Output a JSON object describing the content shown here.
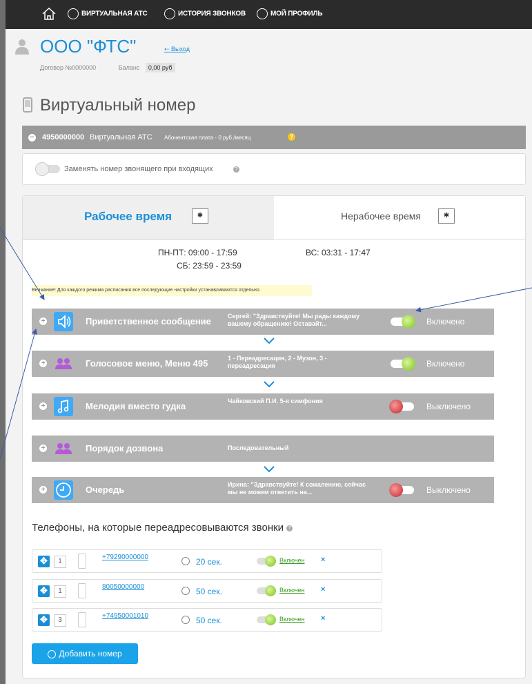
{
  "nav": {
    "pbx": "ВИРТУАЛЬНАЯ АТС",
    "history": "ИСТОРИЯ ЗВОНКОВ",
    "profile": "МОЙ ПРОФИЛЬ"
  },
  "company": {
    "name": "ООО \"ФТС\"",
    "logout": "Выход",
    "contract": "Договор №0000000",
    "balance_label": "Баланс",
    "balance_value": "0,00 руб"
  },
  "section_title": "Виртуальный номер",
  "vnumber": {
    "number": "4950000000",
    "type": "Виртуальная АТС",
    "fee": "Абонентская плата - 0 руб./месяц"
  },
  "replace_caller": "Заменять номер звонящего при входящих",
  "tabs": {
    "work": "Рабочее время",
    "off": "Нерабочее время"
  },
  "schedule": {
    "weekdays": "ПН-ПТ: 09:00 - 17:59",
    "sunday": "ВС: 03:31 - 17:47",
    "saturday": "СБ: 23:59 - 23:59"
  },
  "warning": "Внимание! Для каждого режима расписания все последующие настройки устанавливаются отдельно.",
  "features": [
    {
      "title": "Приветственное сообщение",
      "desc": "Сергей: \"Здравствуйте! Мы рады каждому вашему обращению! Оставайт...",
      "state": "Включено",
      "on": true,
      "icon": "speaker-icon"
    },
    {
      "title": "Голосовое меню, Меню 495",
      "desc": "1 - Переадресация, 2 - Музон, 3 - переадресация",
      "state": "Включено",
      "on": true,
      "icon": "people-icon"
    },
    {
      "title": "Мелодия вместо гудка",
      "desc": "Чайковский П.И. 5-я симфония",
      "state": "Выключено",
      "on": false,
      "icon": "music-note-icon"
    },
    {
      "title": "Порядок дозвона",
      "desc": "Последовательный",
      "state": "",
      "on": null,
      "icon": "people-icon"
    },
    {
      "title": "Очередь",
      "desc": "Ирина: \"Здравствуйте! К сожалению, сейчас мы не можем ответить на...",
      "state": "Выключено",
      "on": false,
      "icon": "clock-icon"
    }
  ],
  "forward_title": "Телефоны, на которые переадресовываются звонки",
  "phones": [
    {
      "order": "1",
      "number": "+79290000000",
      "timeout": "20 сек.",
      "state": "Включен",
      "delete": "×"
    },
    {
      "order": "1",
      "number": "80050000000",
      "timeout": "50 сек.",
      "state": "Включен",
      "delete": "×"
    },
    {
      "order": "3",
      "number": "+74950001010",
      "timeout": "50 сек.",
      "state": "Включен",
      "delete": "×"
    }
  ],
  "add_button": "Добавить номер",
  "colors": {
    "accent": "#1a8fd8",
    "button": "#1aa3e8",
    "row_bg": "#b3b3b3",
    "on": "#7cc21f",
    "off": "#c9222a"
  }
}
